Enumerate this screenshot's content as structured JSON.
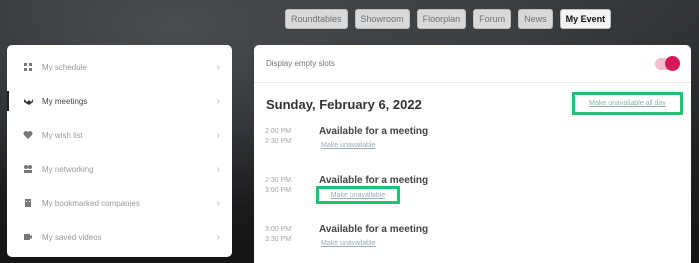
{
  "nav": {
    "items": [
      {
        "label": "Roundtables"
      },
      {
        "label": "Showroom"
      },
      {
        "label": "Floorplan"
      },
      {
        "label": "Forum"
      },
      {
        "label": "News"
      },
      {
        "label": "My Event",
        "active": true
      }
    ]
  },
  "sidebar": {
    "items": [
      {
        "label": "My schedule",
        "icon": "schedule-icon"
      },
      {
        "label": "My meetings",
        "icon": "handshake-icon",
        "active": true
      },
      {
        "label": "My wish list",
        "icon": "heart-icon"
      },
      {
        "label": "My networking",
        "icon": "people-icon"
      },
      {
        "label": "My bookmarked companies",
        "icon": "company-icon"
      },
      {
        "label": "My saved videos",
        "icon": "video-icon"
      }
    ]
  },
  "main": {
    "display_empty_label": "Display empty slots",
    "date": "Sunday, February 6, 2022",
    "make_all_unavailable": "Make unavailable all day",
    "slots": [
      {
        "start": "2:00 PM",
        "end": "2:30 PM",
        "title": "Available for a meeting",
        "action": "Make unavailable"
      },
      {
        "start": "2:30 PM",
        "end": "3:00 PM",
        "title": "Available for a meeting",
        "action": "Make unavailable"
      },
      {
        "start": "3:00 PM",
        "end": "3:30 PM",
        "title": "Available for a meeting",
        "action": "Make unavailable"
      }
    ]
  },
  "colors": {
    "accent": "#d5175a",
    "highlight": "#22c178"
  }
}
